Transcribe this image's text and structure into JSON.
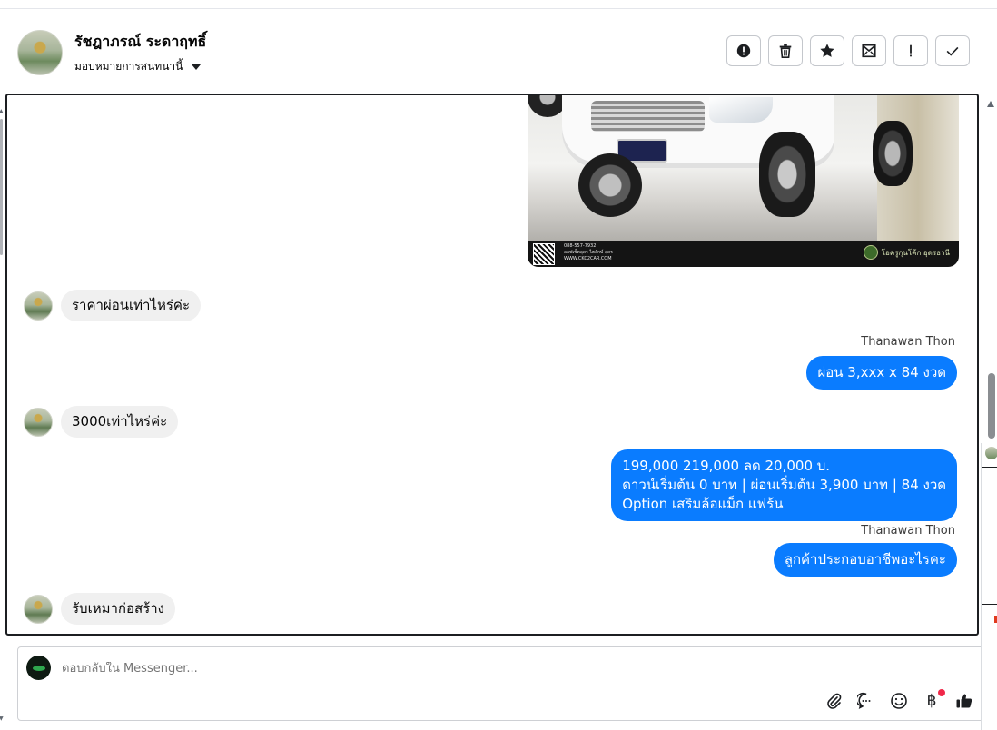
{
  "header": {
    "contact_name": "รัชฎาภรณ์ ระดาฤทธิ์",
    "assign_label": "มอบหมายการสนทนานี้",
    "toolbar": [
      {
        "name": "spam-button",
        "icon": "alert-circle-icon"
      },
      {
        "name": "delete-button",
        "icon": "trash-icon"
      },
      {
        "name": "star-button",
        "icon": "star-icon"
      },
      {
        "name": "mark-unread-button",
        "icon": "envelope-icon"
      },
      {
        "name": "important-button",
        "icon": "exclamation-icon"
      },
      {
        "name": "done-button",
        "icon": "check-icon"
      }
    ]
  },
  "image_banner": {
    "phone": "088-557-7932",
    "line": "ออฟเซ็ตอุดร ไฮลักษ์ อุดร",
    "url": "WWW.CKC2CAR.COM",
    "brand": "โอครูกุนโค้ก อุดรธานี"
  },
  "messages": [
    {
      "direction": "in",
      "text": "ราคาผ่อนเท่าไหร่ค่ะ"
    },
    {
      "direction": "out",
      "sender": "Thanawan Thon",
      "text": "ผ่อน 3,xxx x 84 งวด"
    },
    {
      "direction": "in",
      "text": "3000เท่าไหร่ค่ะ"
    },
    {
      "direction": "out",
      "text": "199,000 219,000 ลด 20,000 บ.\nดาวน์เริ่มต้น 0 บาท | ผ่อนเริ่มต้น 3,900 บาท | 84 งวด\n Option เสริมล้อแม็ก แฟร้น"
    },
    {
      "direction": "out",
      "sender": "Thanawan Thon",
      "text": "ลูกค้าประกอบอาชีพอะไรคะ"
    },
    {
      "direction": "in",
      "text": "รับเหมาก่อสร้าง"
    }
  ],
  "composer": {
    "placeholder": "ตอบกลับใน Messenger...",
    "tools": [
      "paperclip-icon",
      "chat-bubble-icon",
      "smiley-icon",
      "baht-icon",
      "thumbs-up-icon"
    ],
    "baht_symbol": "฿"
  },
  "colors": {
    "outgoing_bubble": "#0a7cff",
    "incoming_bubble": "#f0f0f0",
    "badge": "#f02849"
  }
}
